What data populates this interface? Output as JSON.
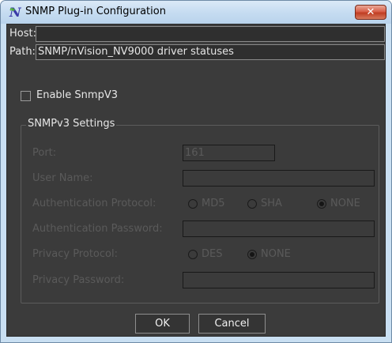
{
  "window": {
    "title": "SNMP Plug-in Configuration",
    "close_glyph": "✕"
  },
  "host": {
    "label": "Host:",
    "value": ""
  },
  "path": {
    "label": "Path:",
    "value": "SNMP/nVision_NV9000 driver statuses"
  },
  "enable_snmpv3": {
    "label": "Enable SnmpV3",
    "checked": false
  },
  "snmpv3": {
    "group_title": "SNMPv3 Settings",
    "port": {
      "label": "Port:",
      "value": "161"
    },
    "user_name": {
      "label": "User Name:",
      "value": ""
    },
    "auth_protocol": {
      "label": "Authentication Protocol:",
      "options": [
        "MD5",
        "SHA",
        "NONE"
      ],
      "selected": "NONE"
    },
    "auth_password": {
      "label": "Authentication Password:",
      "value": ""
    },
    "privacy_protocol": {
      "label": "Privacy Protocol:",
      "options": [
        "DES",
        "NONE"
      ],
      "selected": "NONE"
    },
    "privacy_password": {
      "label": "Privacy Password:",
      "value": ""
    }
  },
  "buttons": {
    "ok": "OK",
    "cancel": "Cancel"
  },
  "icons": {
    "app": "nvision-app-icon",
    "close": "close-icon"
  }
}
